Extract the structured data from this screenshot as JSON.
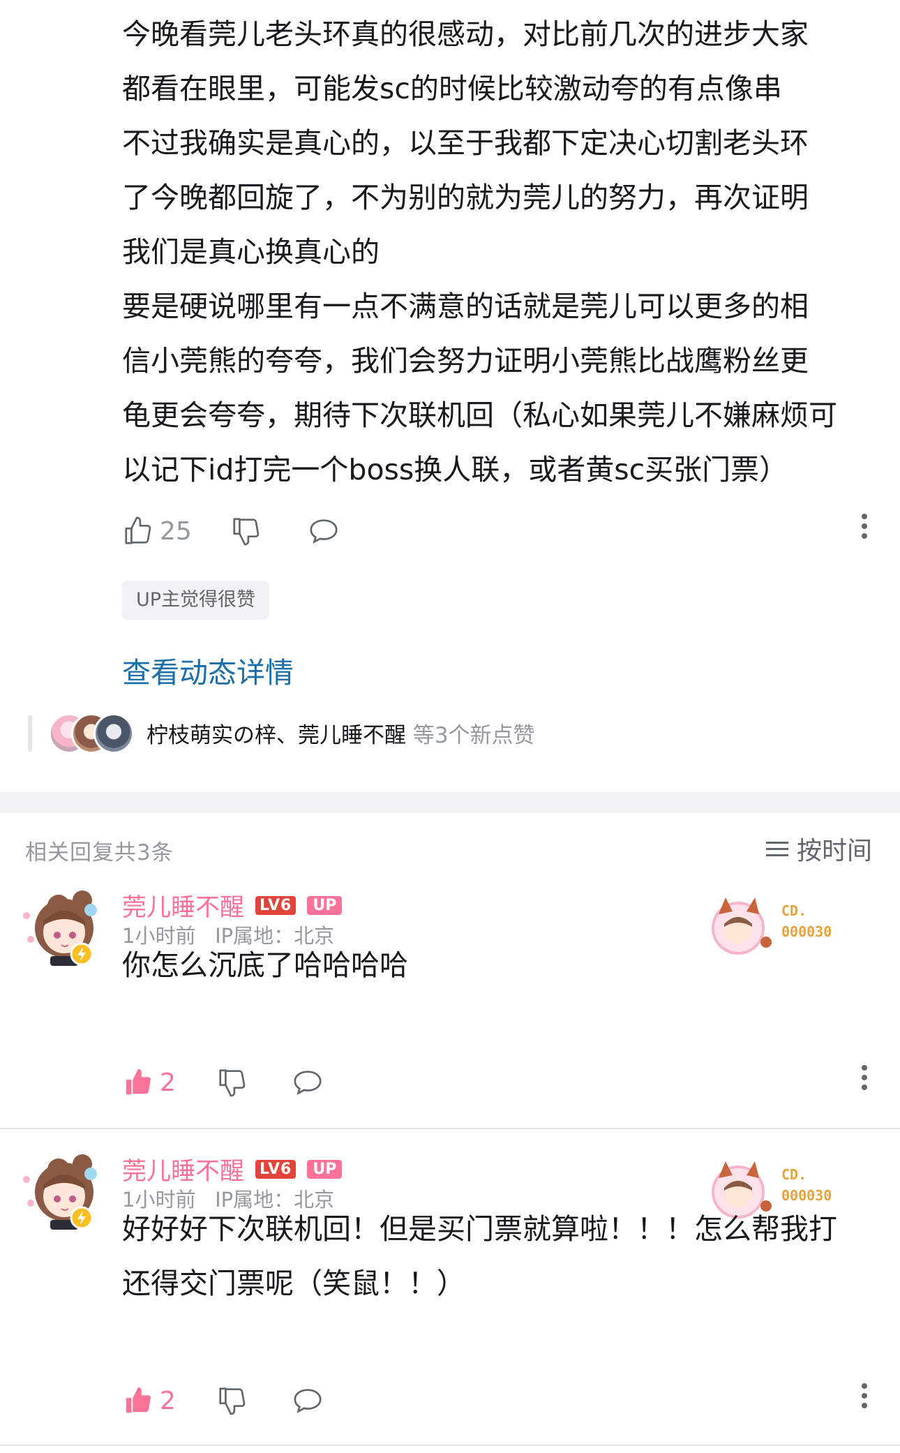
{
  "post": {
    "lines": [
      "今晚看莞儿老头环真的很感动，对比前几次的进步大家",
      "都看在眼里，可能发sc的时候比较激动夸的有点像串",
      "不过我确实是真心的，以至于我都下定决心切割老头环",
      "了今晚都回旋了，不为别的就为莞儿的努力，再次证明",
      "我们是真心换真心的",
      "要是硬说哪里有一点不满意的话就是莞儿可以更多的相",
      "信小莞熊的夸夸，我们会努力证明小莞熊比战鹰粉丝更",
      "龟更会夸夸，期待下次联机回（私心如果莞儿不嫌麻烦可",
      "以记下id打完一个boss换人联，或者黄sc买张门票）"
    ],
    "like_count": "25",
    "up_liked_label": "UP主觉得很赞",
    "view_detail_link": "查看动态详情",
    "likers_names": "柠枝萌实の梓、莞儿睡不醒",
    "likers_suffix": "等3个新点赞"
  },
  "replies_section": {
    "header": "相关回复共3条",
    "sort_label": "按时间"
  },
  "replies": [
    {
      "username": "莞儿睡不醒",
      "level": "LV6",
      "up_badge": "UP",
      "time": "1小时前",
      "ip": "IP属地：北京",
      "lines": [
        "你怎么沉底了哈哈哈哈"
      ],
      "like_count": "2",
      "deco_line1": "CD.",
      "deco_line2": "000030"
    },
    {
      "username": "莞儿睡不醒",
      "level": "LV6",
      "up_badge": "UP",
      "time": "1小时前",
      "ip": "IP属地：北京",
      "lines": [
        "好好好下次联机回！但是买门票就算啦！！！怎么帮我打",
        "还得交门票呢（笑鼠！！）"
      ],
      "like_count": "2",
      "deco_line1": "CD.",
      "deco_line2": "000030"
    }
  ],
  "colors": {
    "link": "#1a6fa8",
    "username_pink": "#fb7299",
    "liked_pink": "#fb7299",
    "muted": "#9499a0"
  }
}
